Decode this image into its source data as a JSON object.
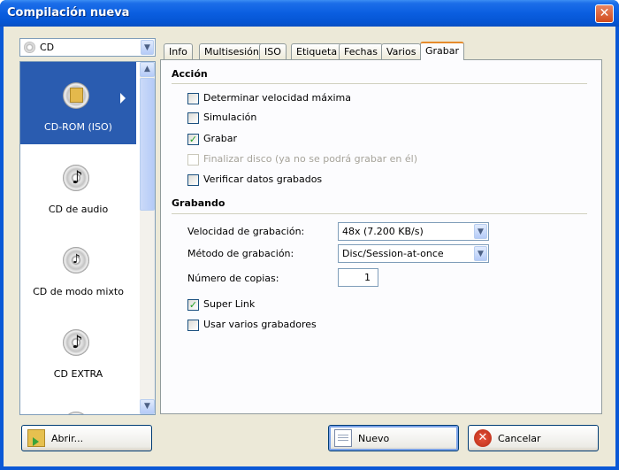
{
  "window": {
    "title": "Compilación nueva"
  },
  "disc_type_combo": {
    "value": "CD"
  },
  "project_list": {
    "items": [
      {
        "label": "CD-ROM (ISO)",
        "selected": true
      },
      {
        "label": "CD de audio",
        "selected": false
      },
      {
        "label": "CD de modo mixto",
        "selected": false
      },
      {
        "label": "CD EXTRA",
        "selected": false
      }
    ]
  },
  "tabs": [
    "Info",
    "Multisesión",
    "ISO",
    "Etiqueta",
    "Fechas",
    "Varios",
    "Grabar"
  ],
  "active_tab": "Grabar",
  "accion": {
    "title": "Acción",
    "options": [
      {
        "label": "Determinar velocidad máxima",
        "checked": false,
        "enabled": true
      },
      {
        "label": "Simulación",
        "checked": false,
        "enabled": true
      },
      {
        "label": "Grabar",
        "checked": true,
        "enabled": true
      },
      {
        "label": "Finalizar disco (ya no se podrá grabar en él)",
        "checked": false,
        "enabled": false
      },
      {
        "label": "Verificar datos grabados",
        "checked": false,
        "enabled": true
      }
    ]
  },
  "grabando": {
    "title": "Grabando",
    "speed_label": "Velocidad de grabación:",
    "speed_value": "48x (7.200 KB/s)",
    "method_label": "Método de grabación:",
    "method_value": "Disc/Session-at-once",
    "copies_label": "Número de copias:",
    "copies_value": "1",
    "super_link": {
      "label": "Super Link",
      "checked": true
    },
    "multi_writers": {
      "label": "Usar varios grabadores",
      "checked": false
    }
  },
  "buttons": {
    "open": "Abrir...",
    "new": "Nuevo",
    "cancel": "Cancelar"
  },
  "icons": {
    "close": "close-icon",
    "check": "✓",
    "dropdown": "chevron-down-icon"
  },
  "colors": {
    "titlebar": "#0a58d6",
    "selection": "#2a5cb0",
    "tab_accent": "#e68b2c",
    "checkmark": "#21a121"
  }
}
